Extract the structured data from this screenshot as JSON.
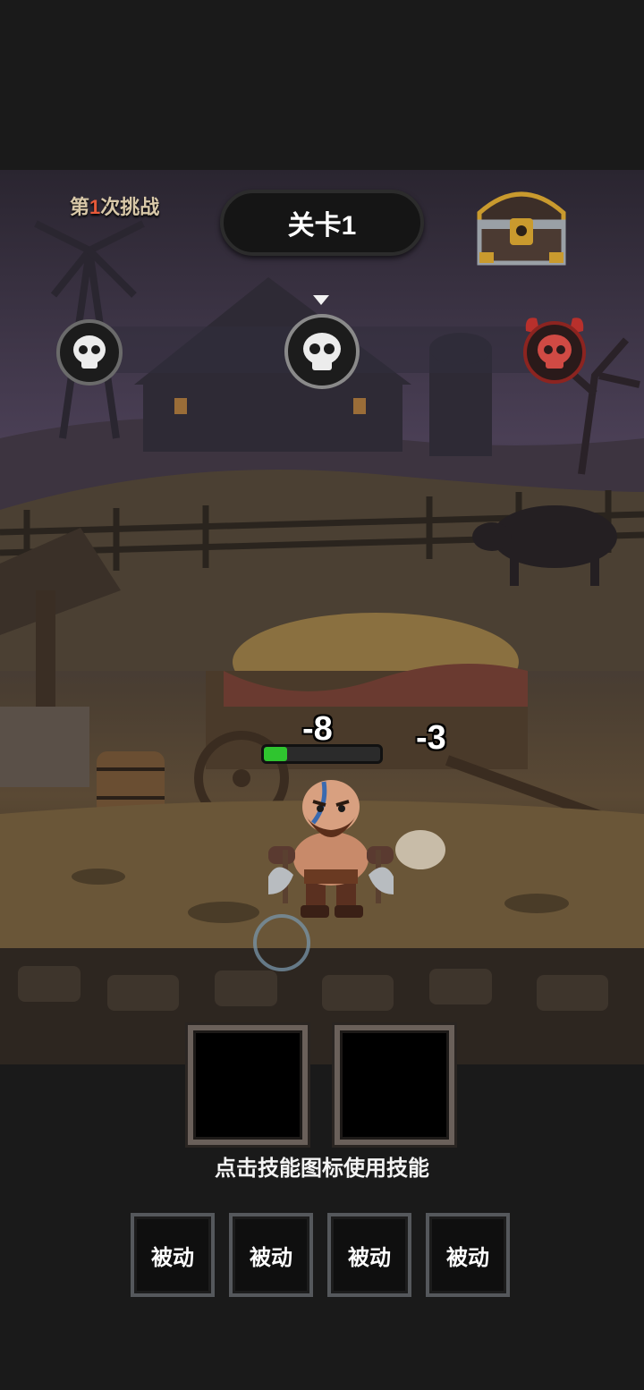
{
  "hud": {
    "challenge_prefix": "第",
    "challenge_count": "1",
    "challenge_suffix": "次挑战",
    "level_title": "关卡1",
    "chest_icon": "treasure-chest-icon"
  },
  "stage_track": {
    "nodes": [
      {
        "icon": "skull-icon",
        "type": "normal",
        "current": false
      },
      {
        "icon": "skull-icon",
        "type": "normal",
        "current": true
      },
      {
        "icon": "demon-skull-icon",
        "type": "boss",
        "current": false
      }
    ]
  },
  "combat": {
    "damage_numbers": [
      "-8",
      "-3"
    ],
    "hero_hp_fraction": 0.2,
    "hp_color": "#2fc52f"
  },
  "skills": {
    "active_slots": [
      {
        "label": ""
      },
      {
        "label": ""
      }
    ],
    "hint": "点击技能图标使用技能",
    "passive_slots": [
      {
        "label": "被动"
      },
      {
        "label": "被动"
      },
      {
        "label": "被动"
      },
      {
        "label": "被动"
      }
    ]
  },
  "colors": {
    "background": "#1a1a1a",
    "challenge_number": "#e85a3a",
    "boss_node": "#b8302c"
  }
}
